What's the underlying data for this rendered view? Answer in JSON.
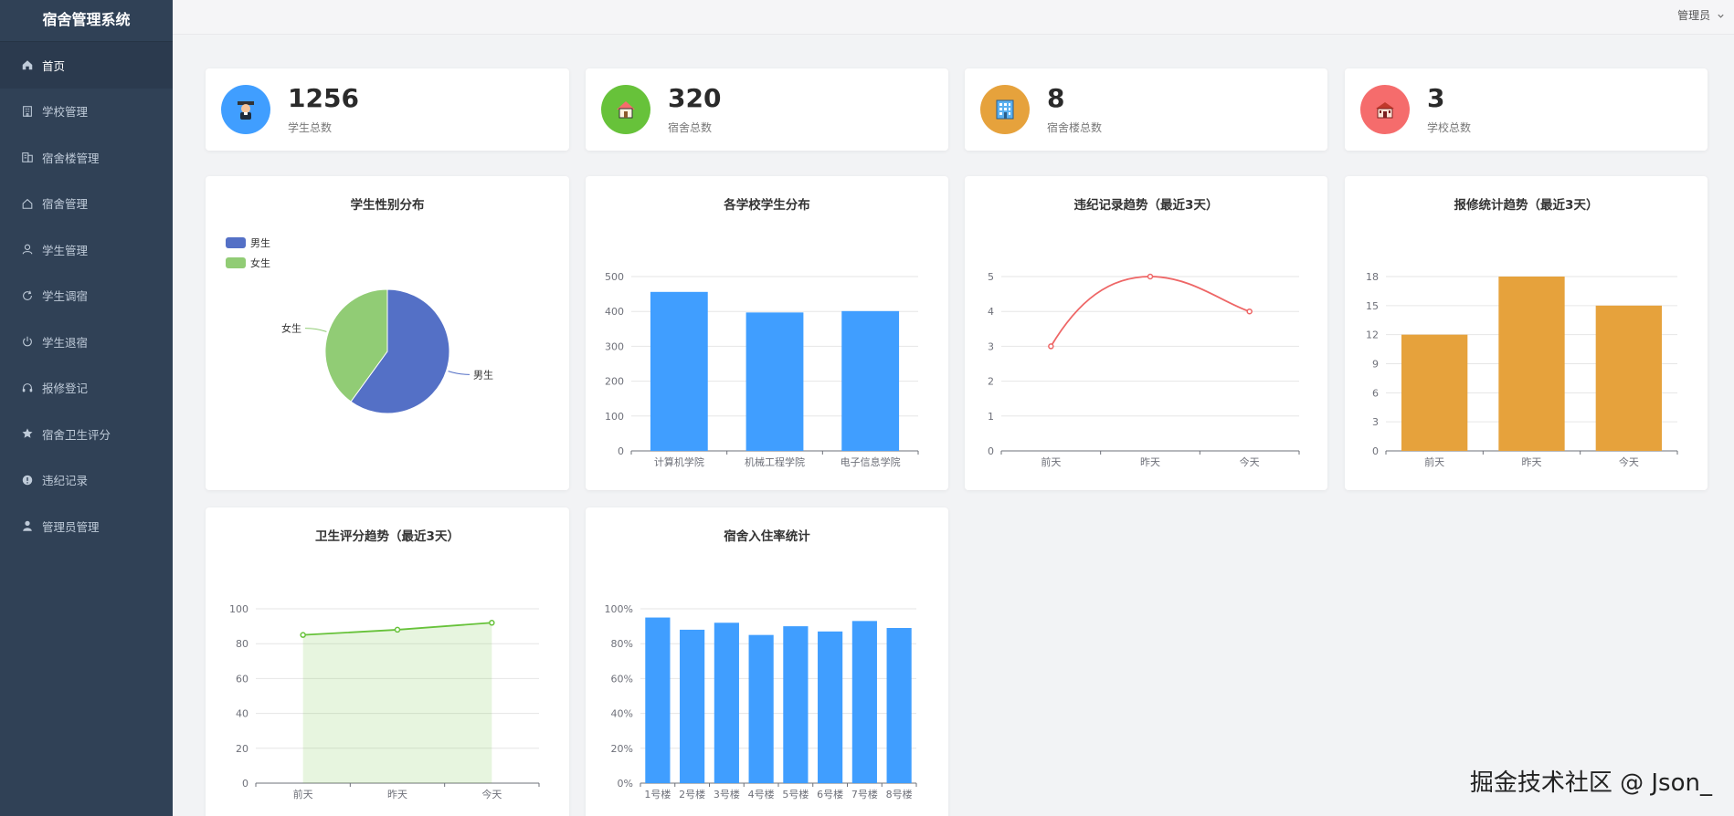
{
  "app": {
    "title": "宿舍管理系统"
  },
  "topbar": {
    "user_label": "管理员"
  },
  "menu": [
    {
      "label": "首页",
      "icon": "home-icon"
    },
    {
      "label": "学校管理",
      "icon": "school-icon"
    },
    {
      "label": "宿舍楼管理",
      "icon": "building-icon"
    },
    {
      "label": "宿舍管理",
      "icon": "house-icon"
    },
    {
      "label": "学生管理",
      "icon": "user-icon"
    },
    {
      "label": "学生调宿",
      "icon": "refresh-icon"
    },
    {
      "label": "学生退宿",
      "icon": "power-icon"
    },
    {
      "label": "报修登记",
      "icon": "headset-icon"
    },
    {
      "label": "宿舍卫生评分",
      "icon": "star-icon"
    },
    {
      "label": "违纪记录",
      "icon": "warning-icon"
    },
    {
      "label": "管理员管理",
      "icon": "admin-icon"
    }
  ],
  "stats": [
    {
      "value": "1256",
      "label": "学生总数",
      "icon": "student-icon",
      "color": "#409eff"
    },
    {
      "value": "320",
      "label": "宿舍总数",
      "icon": "home-icon",
      "color": "#67c23a"
    },
    {
      "value": "8",
      "label": "宿舍楼总数",
      "icon": "building-icon",
      "color": "#e6a23c"
    },
    {
      "value": "3",
      "label": "学校总数",
      "icon": "school-icon",
      "color": "#f56c6c"
    }
  ],
  "watermark": "掘金技术社区 @ Json_",
  "chart_data": [
    {
      "type": "pie",
      "title": "学生性别分布",
      "legend": "top-left",
      "slices": [
        {
          "label": "男生",
          "value": 60,
          "color": "#5470c6"
        },
        {
          "label": "女生",
          "value": 40,
          "color": "#91cc75"
        }
      ]
    },
    {
      "type": "bar",
      "title": "各学校学生分布",
      "categories": [
        "计算机学院",
        "机械工程学院",
        "电子信息学院"
      ],
      "values": [
        456,
        397,
        401
      ],
      "ylim": [
        0,
        500
      ],
      "yticks": [
        "0",
        "100",
        "200",
        "300",
        "400",
        "500"
      ],
      "color": "#409eff"
    },
    {
      "type": "line",
      "title": "违纪记录趋势（最近3天）",
      "categories": [
        "前天",
        "昨天",
        "今天"
      ],
      "values": [
        3,
        5,
        4
      ],
      "ylim": [
        0,
        5
      ],
      "yticks": [
        "0",
        "1",
        "2",
        "3",
        "4",
        "5"
      ],
      "color": "#ee6666"
    },
    {
      "type": "bar",
      "title": "报修统计趋势（最近3天）",
      "categories": [
        "前天",
        "昨天",
        "今天"
      ],
      "values": [
        12,
        18,
        15
      ],
      "ylim": [
        0,
        18
      ],
      "yticks": [
        "0",
        "3",
        "6",
        "9",
        "12",
        "15",
        "18"
      ],
      "color": "#e6a23c"
    },
    {
      "type": "area",
      "title": "卫生评分趋势（最近3天）",
      "categories": [
        "前天",
        "昨天",
        "今天"
      ],
      "values": [
        85,
        88,
        92
      ],
      "ylim": [
        0,
        100
      ],
      "yticks": [
        "0",
        "20",
        "40",
        "60",
        "80",
        "100"
      ],
      "color": "#67c23a"
    },
    {
      "type": "bar",
      "title": "宿舍入住率统计",
      "categories": [
        "1号楼",
        "2号楼",
        "3号楼",
        "4号楼",
        "5号楼",
        "6号楼",
        "7号楼",
        "8号楼"
      ],
      "values": [
        95,
        88,
        92,
        85,
        90,
        87,
        93,
        89
      ],
      "ylim": [
        0,
        100
      ],
      "yticks": [
        "0%",
        "20%",
        "40%",
        "60%",
        "80%",
        "100%"
      ],
      "color": "#409eff"
    }
  ]
}
